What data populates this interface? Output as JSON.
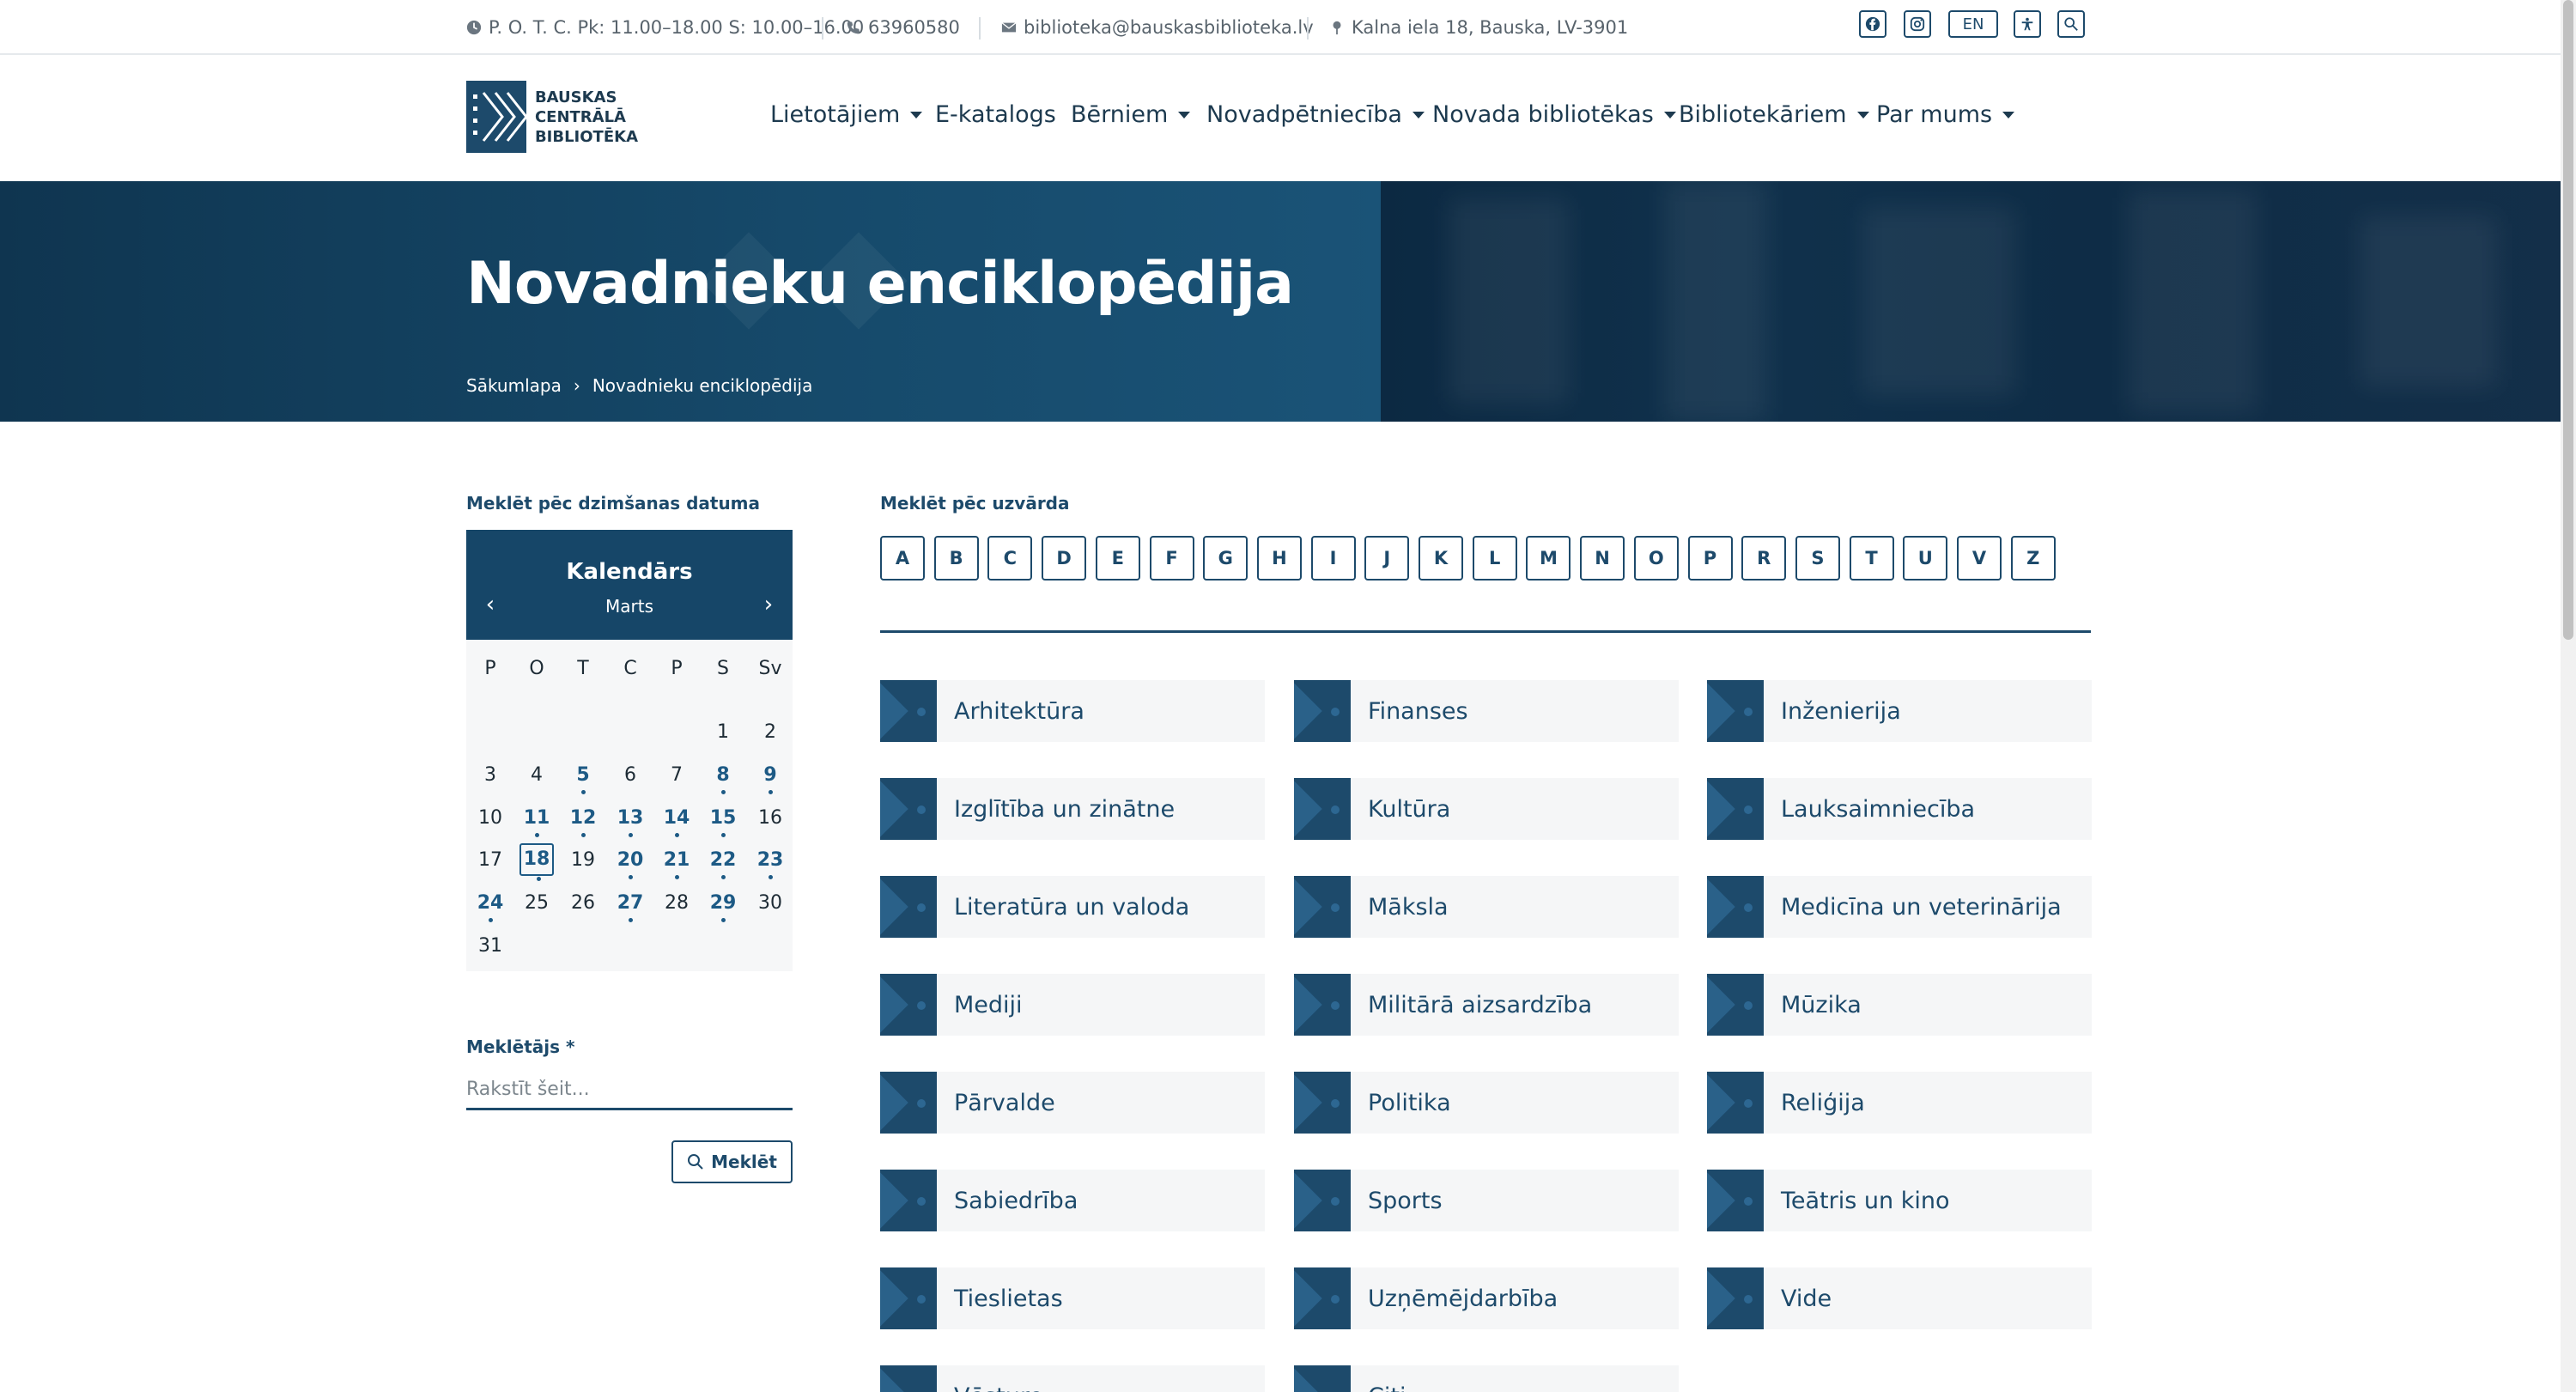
{
  "topbar": {
    "hours": "P. O. T. C. Pk: 11.00–18.00 S: 10.00–16.00",
    "phone": "63960580",
    "email": "biblioteka@bauskasbiblioteka.lv",
    "address": "Kalna iela 18, Bauska, LV-3901",
    "lang": "EN",
    "icons": [
      "facebook-icon",
      "instagram-icon",
      "accessibility-icon",
      "search-icon"
    ]
  },
  "logo": {
    "line1": "BAUSKAS",
    "line2": "CENTRĀLĀ",
    "line3": "BIBLIOTĒKA"
  },
  "nav": {
    "items": [
      {
        "label": "Lietotājiem",
        "dropdown": true
      },
      {
        "label": "E-katalogs",
        "dropdown": false
      },
      {
        "label": "Bērniem",
        "dropdown": true
      },
      {
        "label": "Novadpētniecība",
        "dropdown": true
      },
      {
        "label": "Novada bibliotēkas",
        "dropdown": true
      },
      {
        "label": "Bibliotekāriem",
        "dropdown": true
      },
      {
        "label": "Par mums",
        "dropdown": true
      }
    ]
  },
  "hero": {
    "title": "Novadnieku enciklopēdija",
    "breadcrumb": {
      "home": "Sākumlapa",
      "separator": "›",
      "current": "Novadnieku enciklopēdija"
    }
  },
  "sidebar": {
    "date_label": "Meklēt pēc dzimšanas datuma",
    "calendar": {
      "title": "Kalendārs",
      "month": "Marts",
      "weekdays": [
        "P",
        "O",
        "T",
        "C",
        "P",
        "S",
        "Sv"
      ],
      "today": 18,
      "event_days": [
        5,
        8,
        9,
        11,
        12,
        13,
        14,
        15,
        18,
        20,
        21,
        22,
        23,
        24,
        27,
        29
      ]
    },
    "search_label": "Meklētājs *",
    "search_placeholder": "Rakstīt šeit...",
    "search_button": "Meklēt"
  },
  "letters": {
    "label": "Meklēt pēc uzvārda",
    "items": [
      "A",
      "B",
      "C",
      "D",
      "E",
      "F",
      "G",
      "H",
      "I",
      "J",
      "K",
      "L",
      "M",
      "N",
      "O",
      "P",
      "R",
      "S",
      "T",
      "U",
      "V",
      "Z"
    ]
  },
  "categories": [
    "Arhitektūra",
    "Finanses",
    "Inženierija",
    "Izglītība un zinātne",
    "Kultūra",
    "Lauksaimniecība",
    "Literatūra un valoda",
    "Māksla",
    "Medicīna un veterinārija",
    "Mediji",
    "Militārā aizsardzība",
    "Mūzika",
    "Pārvalde",
    "Politika",
    "Reliģija",
    "Sabiedrība",
    "Sports",
    "Teātris un kino",
    "Tieslietas",
    "Uzņēmējdarbība",
    "Vide",
    "Vēsture",
    "Citi"
  ],
  "colors": {
    "primary": "#1d4a6b",
    "hero": "#164a6b",
    "text": "#1d3a4f"
  }
}
